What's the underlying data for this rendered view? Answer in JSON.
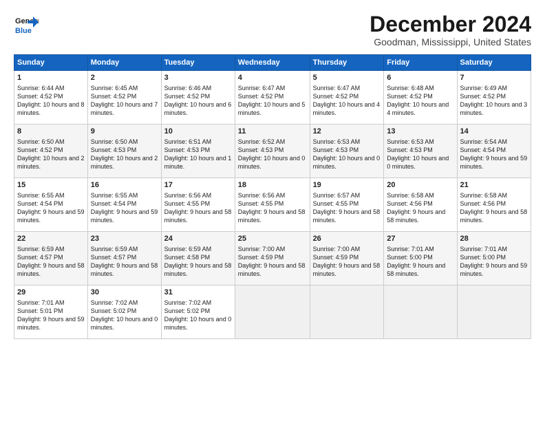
{
  "logo": {
    "line1": "General",
    "line2": "Blue"
  },
  "title": "December 2024",
  "location": "Goodman, Mississippi, United States",
  "days_of_week": [
    "Sunday",
    "Monday",
    "Tuesday",
    "Wednesday",
    "Thursday",
    "Friday",
    "Saturday"
  ],
  "weeks": [
    [
      {
        "day": 1,
        "sunrise": "6:44 AM",
        "sunset": "4:52 PM",
        "daylight": "10 hours and 8 minutes."
      },
      {
        "day": 2,
        "sunrise": "6:45 AM",
        "sunset": "4:52 PM",
        "daylight": "10 hours and 7 minutes."
      },
      {
        "day": 3,
        "sunrise": "6:46 AM",
        "sunset": "4:52 PM",
        "daylight": "10 hours and 6 minutes."
      },
      {
        "day": 4,
        "sunrise": "6:47 AM",
        "sunset": "4:52 PM",
        "daylight": "10 hours and 5 minutes."
      },
      {
        "day": 5,
        "sunrise": "6:47 AM",
        "sunset": "4:52 PM",
        "daylight": "10 hours and 4 minutes."
      },
      {
        "day": 6,
        "sunrise": "6:48 AM",
        "sunset": "4:52 PM",
        "daylight": "10 hours and 4 minutes."
      },
      {
        "day": 7,
        "sunrise": "6:49 AM",
        "sunset": "4:52 PM",
        "daylight": "10 hours and 3 minutes."
      }
    ],
    [
      {
        "day": 8,
        "sunrise": "6:50 AM",
        "sunset": "4:52 PM",
        "daylight": "10 hours and 2 minutes."
      },
      {
        "day": 9,
        "sunrise": "6:50 AM",
        "sunset": "4:53 PM",
        "daylight": "10 hours and 2 minutes."
      },
      {
        "day": 10,
        "sunrise": "6:51 AM",
        "sunset": "4:53 PM",
        "daylight": "10 hours and 1 minute."
      },
      {
        "day": 11,
        "sunrise": "6:52 AM",
        "sunset": "4:53 PM",
        "daylight": "10 hours and 0 minutes."
      },
      {
        "day": 12,
        "sunrise": "6:53 AM",
        "sunset": "4:53 PM",
        "daylight": "10 hours and 0 minutes."
      },
      {
        "day": 13,
        "sunrise": "6:53 AM",
        "sunset": "4:53 PM",
        "daylight": "10 hours and 0 minutes."
      },
      {
        "day": 14,
        "sunrise": "6:54 AM",
        "sunset": "4:54 PM",
        "daylight": "9 hours and 59 minutes."
      }
    ],
    [
      {
        "day": 15,
        "sunrise": "6:55 AM",
        "sunset": "4:54 PM",
        "daylight": "9 hours and 59 minutes."
      },
      {
        "day": 16,
        "sunrise": "6:55 AM",
        "sunset": "4:54 PM",
        "daylight": "9 hours and 59 minutes."
      },
      {
        "day": 17,
        "sunrise": "6:56 AM",
        "sunset": "4:55 PM",
        "daylight": "9 hours and 58 minutes."
      },
      {
        "day": 18,
        "sunrise": "6:56 AM",
        "sunset": "4:55 PM",
        "daylight": "9 hours and 58 minutes."
      },
      {
        "day": 19,
        "sunrise": "6:57 AM",
        "sunset": "4:55 PM",
        "daylight": "9 hours and 58 minutes."
      },
      {
        "day": 20,
        "sunrise": "6:58 AM",
        "sunset": "4:56 PM",
        "daylight": "9 hours and 58 minutes."
      },
      {
        "day": 21,
        "sunrise": "6:58 AM",
        "sunset": "4:56 PM",
        "daylight": "9 hours and 58 minutes."
      }
    ],
    [
      {
        "day": 22,
        "sunrise": "6:59 AM",
        "sunset": "4:57 PM",
        "daylight": "9 hours and 58 minutes."
      },
      {
        "day": 23,
        "sunrise": "6:59 AM",
        "sunset": "4:57 PM",
        "daylight": "9 hours and 58 minutes."
      },
      {
        "day": 24,
        "sunrise": "6:59 AM",
        "sunset": "4:58 PM",
        "daylight": "9 hours and 58 minutes."
      },
      {
        "day": 25,
        "sunrise": "7:00 AM",
        "sunset": "4:59 PM",
        "daylight": "9 hours and 58 minutes."
      },
      {
        "day": 26,
        "sunrise": "7:00 AM",
        "sunset": "4:59 PM",
        "daylight": "9 hours and 58 minutes."
      },
      {
        "day": 27,
        "sunrise": "7:01 AM",
        "sunset": "5:00 PM",
        "daylight": "9 hours and 58 minutes."
      },
      {
        "day": 28,
        "sunrise": "7:01 AM",
        "sunset": "5:00 PM",
        "daylight": "9 hours and 59 minutes."
      }
    ],
    [
      {
        "day": 29,
        "sunrise": "7:01 AM",
        "sunset": "5:01 PM",
        "daylight": "9 hours and 59 minutes."
      },
      {
        "day": 30,
        "sunrise": "7:02 AM",
        "sunset": "5:02 PM",
        "daylight": "10 hours and 0 minutes."
      },
      {
        "day": 31,
        "sunrise": "7:02 AM",
        "sunset": "5:02 PM",
        "daylight": "10 hours and 0 minutes."
      },
      null,
      null,
      null,
      null
    ]
  ]
}
